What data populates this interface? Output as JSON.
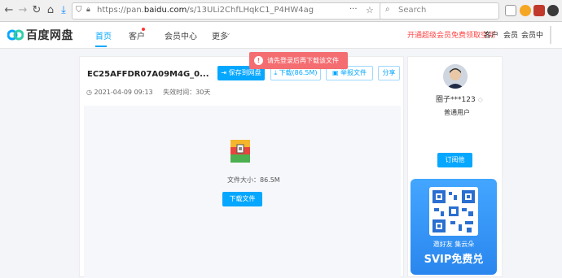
{
  "browser": {
    "url_prefix": "https://pan.",
    "url_domain": "baidu.com",
    "url_path": "/s/13ULi2ChfLHqkC1_P4HW4ag",
    "url_more": "···",
    "search_placeholder": "Search"
  },
  "app": {
    "logo_text": "百度网盘",
    "nav": [
      {
        "label": "首页"
      },
      {
        "label": "客户"
      },
      {
        "label": "会员中心"
      },
      {
        "label": "更多"
      }
    ],
    "promo_link": "开通超级会员免费领取空间",
    "top_links": [
      "客户",
      "会员",
      "会员中"
    ]
  },
  "file": {
    "name": "EC25AFFDR07A09M4G_0...",
    "save_button": "保存到网盘",
    "download_button": "下载(86.5M)",
    "report_button": "举报文件",
    "share_button": "分享",
    "date": "2021-04-09 09:13",
    "expiry": "失效时间：30天",
    "size_text": "文件大小：86.5M",
    "download_center_button": "下载文件"
  },
  "toast": {
    "text": "请先登录后再下载该文件"
  },
  "user": {
    "name": "圈子***123",
    "level": "普通用户",
    "follow_button": "订阅他"
  },
  "promo": {
    "line1": "邀好友 集云朵",
    "line2": "SVIP免费兑"
  },
  "colors": {
    "accent": "#06a7ff",
    "toast": "#f46d71",
    "promo": "#2e8ff0"
  }
}
